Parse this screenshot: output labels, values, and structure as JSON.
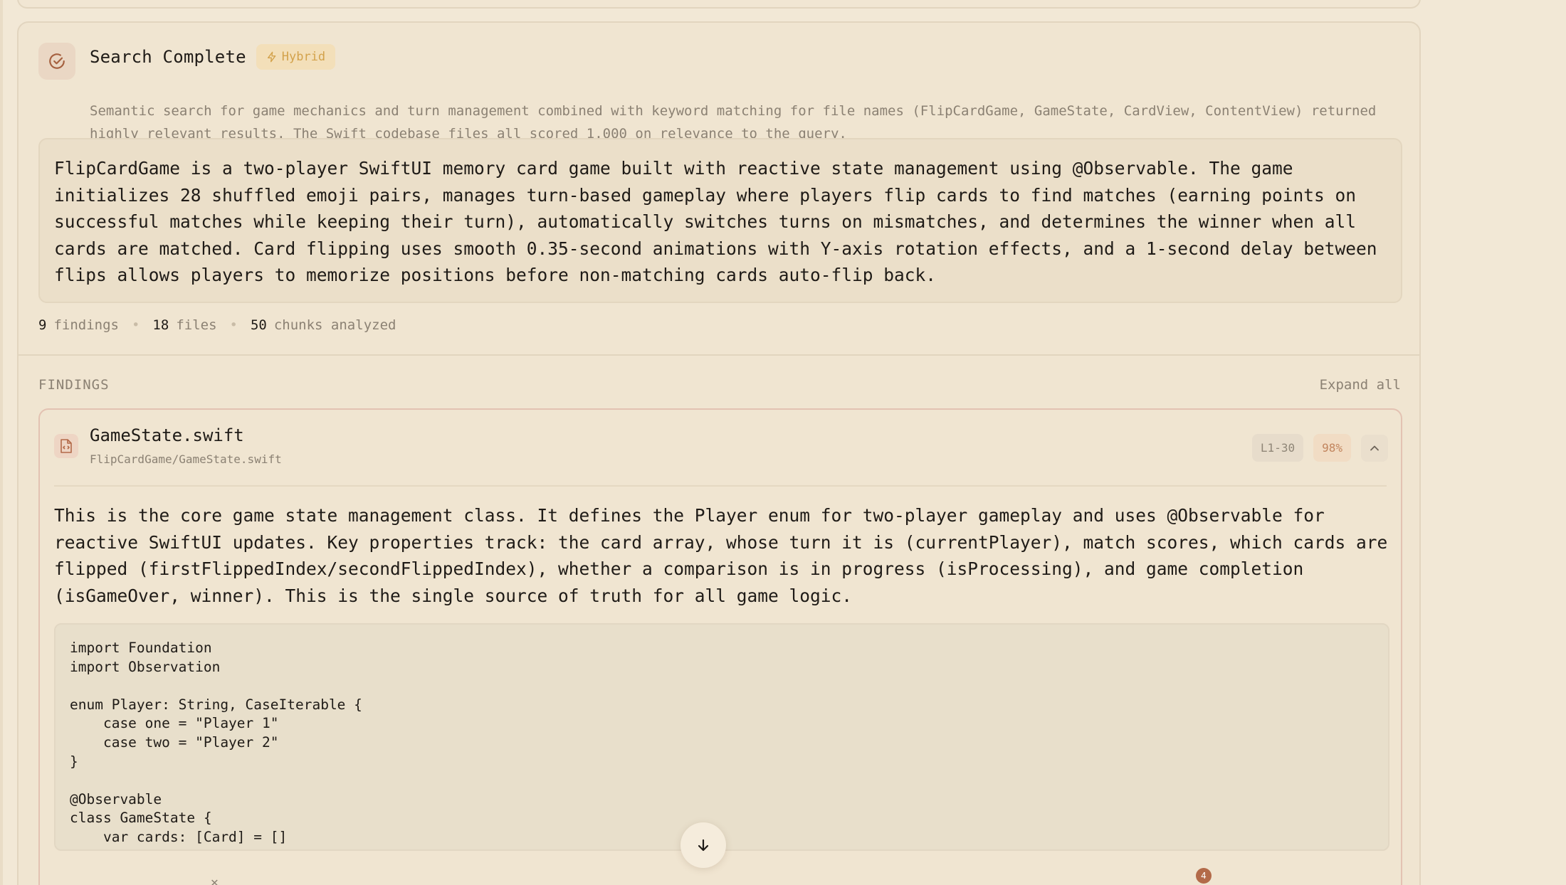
{
  "colors": {
    "background": "#f2e8d6",
    "accent": "#b36a49",
    "hybrid_badge": "#d3a24b",
    "score_badge": "#c2855e"
  },
  "header": {
    "title": "Search Complete",
    "mode_badge": "Hybrid",
    "mode_icon": "lightning-icon",
    "status_icon": "check-circle-icon",
    "description": "Semantic search for game mechanics and turn management combined with keyword matching for file names (FlipCardGame, GameState, CardView, ContentView) returned highly relevant results. The Swift codebase files all scored 1.000 on relevance to the query."
  },
  "summary": "FlipCardGame is a two-player SwiftUI memory card game built with reactive state management using @Observable. The game initializes 28 shuffled emoji pairs, manages turn-based gameplay where players flip cards to find matches (earning points on successful matches while keeping their turn), automatically switches turns on mismatches, and determines the winner when all cards are matched. Card flipping uses smooth 0.35-second animations with Y-axis rotation effects, and a 1-second delay between flips allows players to memorize positions before non-matching cards auto-flip back.",
  "stats": {
    "findings_count": "9",
    "findings_label": "findings",
    "files_count": "18",
    "files_label": "files",
    "chunks_count": "50",
    "chunks_label": "chunks analyzed"
  },
  "findings": {
    "section_label": "FINDINGS",
    "expand_all_label": "Expand all",
    "items": [
      {
        "file_name": "GameState.swift",
        "file_path": "FlipCardGame/GameState.swift",
        "lines": "L1-30",
        "score": "98%",
        "icon": "swift-file-icon",
        "explanation": "This is the core game state management class. It defines the Player enum for two-player gameplay and uses @Observable for reactive SwiftUI updates. Key properties track: the card array, whose turn it is (currentPlayer), match scores, which cards are flipped (firstFlippedIndex/secondFlippedIndex), whether a comparison is in progress (isProcessing), and game completion (isGameOver, winner). This is the single source of truth for all game logic.",
        "code": "import Foundation\nimport Observation\n\nenum Player: String, CaseIterable {\n    case one = \"Player 1\"\n    case two = \"Player 2\"\n}\n\n@Observable\nclass GameState {\n    var cards: [Card] = []"
      }
    ]
  },
  "notifications": {
    "count": "4"
  }
}
